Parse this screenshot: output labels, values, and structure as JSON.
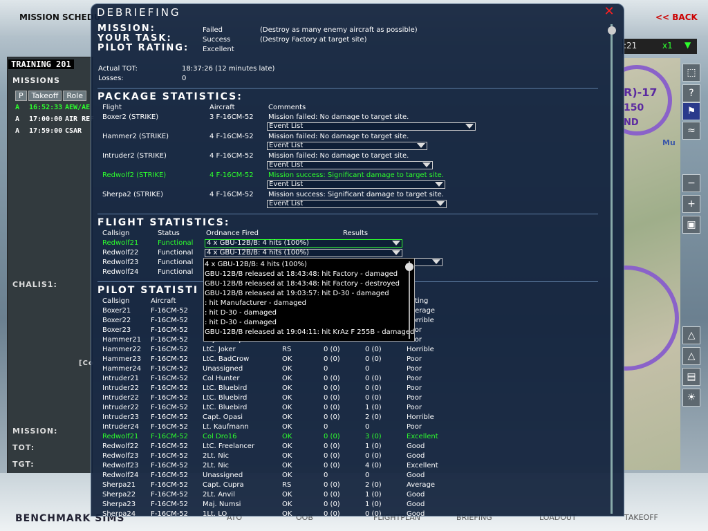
{
  "background": {
    "title": "MISSION SCHEDU",
    "back_label": "<< BACK",
    "left_panel": {
      "header": "TRAINING 201",
      "missions_label": "MISSIONS",
      "columns": [
        "P",
        "Takeoff",
        "Role"
      ],
      "rows": [
        {
          "p": "A",
          "takeoff": "16:52:33",
          "role": "AEW/AE"
        },
        {
          "p": "A",
          "takeoff": "17:00:00",
          "role": "AIR REF"
        },
        {
          "p": "A",
          "takeoff": "17:59:00",
          "role": "CSAR"
        }
      ],
      "chalis_label": "CHALIS1:",
      "co_label": "[Co",
      "mission_label": "MISSION:",
      "tot_label": "TOT:",
      "tgt_label": "TGT:"
    },
    "map_time": ":21",
    "map_speed": "x1",
    "map_labels": [
      "R)-17",
      "150",
      "ND",
      "Mu"
    ],
    "brand": "BENCHMARK SIMS",
    "nav_tabs": [
      "ATO",
      "OOB",
      "FLIGHTPLAN",
      "BRIEFING",
      "LOADOUT",
      "TAKEOFF"
    ]
  },
  "debriefing": {
    "title": "DEBRIEFING",
    "mission_label": "MISSION:",
    "mission_status": "Failed",
    "mission_desc": "(Destroy as many enemy aircraft as possible)",
    "task_label": "YOUR TASK:",
    "task_status": "Success",
    "task_desc": "(Destroy Factory at target site)",
    "rating_label": "PILOT RATING:",
    "rating_value": "Excellent",
    "tot_label": "Actual TOT:",
    "tot_value": "18:37:26 (12 minutes late)",
    "losses_label": "Losses:",
    "losses_value": "0",
    "package": {
      "title": "PACKAGE STATISTICS:",
      "headers": [
        "Flight",
        "Aircraft",
        "Comments"
      ],
      "event_label": "Event List",
      "rows": [
        {
          "flight": "Boxer2 (STRIKE)",
          "aircraft": "3 F-16CM-52",
          "comment": "Mission failed: No damage to target site.",
          "green": false
        },
        {
          "flight": "Hammer2 (STRIKE)",
          "aircraft": "4 F-16CM-52",
          "comment": "Mission failed: No damage to target site.",
          "green": false
        },
        {
          "flight": "Intruder2 (STRIKE)",
          "aircraft": "4 F-16CM-52",
          "comment": "Mission failed: No damage to target site.",
          "green": false
        },
        {
          "flight": "Redwolf2 (STRIKE)",
          "aircraft": "4 F-16CM-52",
          "comment": "Mission success: Significant damage to target site.",
          "green": true
        },
        {
          "flight": "Sherpa2 (STRIKE)",
          "aircraft": "4 F-16CM-52",
          "comment": "Mission success: Significant damage to target site.",
          "green": false
        }
      ]
    },
    "flight": {
      "title": "FLIGHT STATISTICS:",
      "headers": [
        "Callsign",
        "Status",
        "Ordnance Fired",
        "Results"
      ],
      "rows": [
        {
          "callsign": "Redwolf21",
          "status": "Functional",
          "ordnance": "4 x GBU-12B/B: 4 hits (100%)",
          "green": true
        },
        {
          "callsign": "Redwolf22",
          "status": "Functional",
          "ordnance": "4 x GBU-12B/B: 4 hits (100%)",
          "green": false
        },
        {
          "callsign": "Redwolf23",
          "status": "Functional",
          "ordnance": "",
          "green": false
        },
        {
          "callsign": "Redwolf24",
          "status": "Functional",
          "ordnance": "",
          "green": false
        }
      ]
    },
    "popup_lines": [
      "4 x GBU-12B/B: 4 hits (100%)",
      "GBU-12B/B released at 18:43:48: hit Factory - damaged",
      "GBU-12B/B released at 18:43:48: hit Factory - destroyed",
      "GBU-12B/B released at 19:03:57: hit D-30 - damaged",
      ": hit Manufacturer - damaged",
      ": hit D-30 - damaged",
      ": hit D-30 - damaged",
      "GBU-12B/B released at 19:04:11: hit KrAz F 255B - damaged"
    ],
    "pilot": {
      "title": "PILOT STATISTI",
      "headers": [
        "Callsign",
        "Aircraft",
        "",
        "",
        "",
        "",
        "ting"
      ],
      "rows": [
        {
          "callsign": "Boxer21",
          "aircraft": "F-16CM-52",
          "pilot": "",
          "status": "",
          "aa": "",
          "ag": "",
          "rating": "Average",
          "green": false
        },
        {
          "callsign": "Boxer22",
          "aircraft": "F-16CM-52",
          "pilot": "",
          "status": "",
          "aa": "",
          "ag": "",
          "rating": "Horrible",
          "green": false
        },
        {
          "callsign": "Boxer23",
          "aircraft": "F-16CM-52",
          "pilot": "",
          "status": "",
          "aa": "",
          "ag": "",
          "rating": "Poor",
          "green": false
        },
        {
          "callsign": "Hammer21",
          "aircraft": "F-16CM-52",
          "pilot": "Maj. Crackpock",
          "status": "",
          "aa": "",
          "ag": "",
          "rating": "Poor",
          "green": false
        },
        {
          "callsign": "Hammer22",
          "aircraft": "F-16CM-52",
          "pilot": "LtC. Joker",
          "status": "RS",
          "aa": "0 (0)",
          "ag": "0 (0)",
          "rating": "Horrible",
          "green": false
        },
        {
          "callsign": "Hammer23",
          "aircraft": "F-16CM-52",
          "pilot": "LtC. BadCrow",
          "status": "OK",
          "aa": "0 (0)",
          "ag": "0 (0)",
          "rating": "Poor",
          "green": false
        },
        {
          "callsign": "Hammer24",
          "aircraft": "F-16CM-52",
          "pilot": "Unassigned",
          "status": "OK",
          "aa": "0",
          "ag": "0",
          "rating": "Poor",
          "green": false
        },
        {
          "callsign": "Intruder21",
          "aircraft": "F-16CM-52",
          "pilot": "Col Hunter",
          "status": "OK",
          "aa": "0 (0)",
          "ag": "0 (0)",
          "rating": "Poor",
          "green": false
        },
        {
          "callsign": "Intruder22",
          "aircraft": "F-16CM-52",
          "pilot": "LtC. Bluebird",
          "status": "OK",
          "aa": "0 (0)",
          "ag": "0 (0)",
          "rating": "Poor",
          "green": false
        },
        {
          "callsign": "Intruder22",
          "aircraft": "F-16CM-52",
          "pilot": "LtC. Bluebird",
          "status": "OK",
          "aa": "0 (0)",
          "ag": "0 (0)",
          "rating": "Poor",
          "green": false
        },
        {
          "callsign": "Intruder22",
          "aircraft": "F-16CM-52",
          "pilot": "LtC. Bluebird",
          "status": "OK",
          "aa": "0 (0)",
          "ag": "1 (0)",
          "rating": "Poor",
          "green": false
        },
        {
          "callsign": "Intruder23",
          "aircraft": "F-16CM-52",
          "pilot": "Capt. Opasi",
          "status": "OK",
          "aa": "0 (0)",
          "ag": "2 (0)",
          "rating": "Horrible",
          "green": false
        },
        {
          "callsign": "Intruder24",
          "aircraft": "F-16CM-52",
          "pilot": "Lt. Kaufmann",
          "status": "OK",
          "aa": "0",
          "ag": "0",
          "rating": "Poor",
          "green": false
        },
        {
          "callsign": "Redwolf21",
          "aircraft": "F-16CM-52",
          "pilot": "Col Dro16",
          "status": "OK",
          "aa": "0 (0)",
          "ag": "3 (0)",
          "rating": "Excellent",
          "green": true
        },
        {
          "callsign": "Redwolf22",
          "aircraft": "F-16CM-52",
          "pilot": "LtC. Freelancer",
          "status": "OK",
          "aa": "0 (0)",
          "ag": "1 (0)",
          "rating": "Good",
          "green": false
        },
        {
          "callsign": "Redwolf23",
          "aircraft": "F-16CM-52",
          "pilot": "2Lt. Nic",
          "status": "OK",
          "aa": "0 (0)",
          "ag": "0 (0)",
          "rating": "Good",
          "green": false
        },
        {
          "callsign": "Redwolf23",
          "aircraft": "F-16CM-52",
          "pilot": "2Lt. Nic",
          "status": "OK",
          "aa": "0 (0)",
          "ag": "4 (0)",
          "rating": "Excellent",
          "green": false
        },
        {
          "callsign": "Redwolf24",
          "aircraft": "F-16CM-52",
          "pilot": "Unassigned",
          "status": "OK",
          "aa": "0",
          "ag": "0",
          "rating": "Good",
          "green": false
        },
        {
          "callsign": "Sherpa21",
          "aircraft": "F-16CM-52",
          "pilot": "Capt. Cupra",
          "status": "RS",
          "aa": "0 (0)",
          "ag": "2 (0)",
          "rating": "Average",
          "green": false
        },
        {
          "callsign": "Sherpa22",
          "aircraft": "F-16CM-52",
          "pilot": "2Lt. Anvil",
          "status": "OK",
          "aa": "0 (0)",
          "ag": "1 (0)",
          "rating": "Good",
          "green": false
        },
        {
          "callsign": "Sherpa23",
          "aircraft": "F-16CM-52",
          "pilot": "Maj. Numsi",
          "status": "OK",
          "aa": "0 (0)",
          "ag": "1 (0)",
          "rating": "Good",
          "green": false
        },
        {
          "callsign": "Sherpa24",
          "aircraft": "F-16CM-52",
          "pilot": "1Lt. LO",
          "status": "OK",
          "aa": "0 (0)",
          "ag": "0 (0)",
          "rating": "Good",
          "green": false
        }
      ]
    }
  },
  "colors": {
    "highlight": "#2dff2d",
    "close": "#ff2020",
    "back": "#cc0000",
    "dialog_bg": "#12223c"
  }
}
